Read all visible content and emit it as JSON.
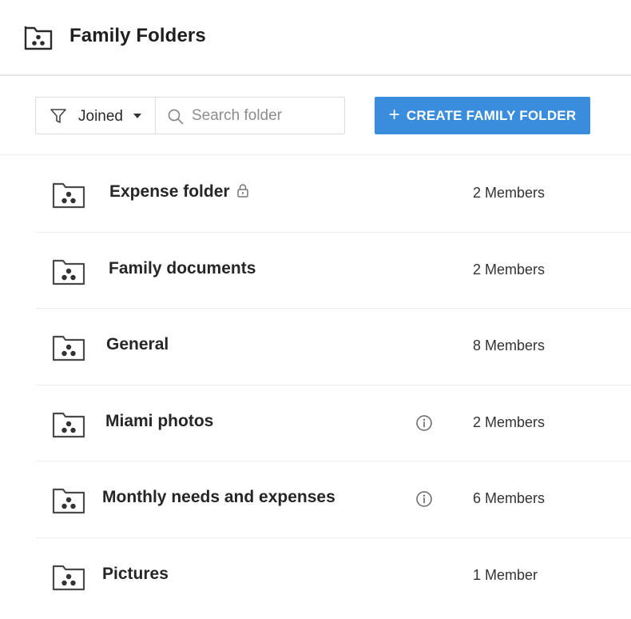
{
  "header": {
    "title": "Family Folders",
    "icon": "family-folder-icon"
  },
  "toolbar": {
    "filter": {
      "icon": "filter-icon",
      "label": "Joined"
    },
    "search": {
      "placeholder": "Search folder",
      "value": ""
    },
    "create_button": {
      "plus": "+",
      "label": "CREATE FAMILY FOLDER"
    }
  },
  "colors": {
    "accent": "#3a8ddc",
    "text": "#262626",
    "border": "#dcdcdc"
  },
  "folders": [
    {
      "name": "Expense folder",
      "locked": true,
      "info": false,
      "members": "2 Members"
    },
    {
      "name": "Family documents",
      "locked": false,
      "info": false,
      "members": "2 Members"
    },
    {
      "name": "General",
      "locked": false,
      "info": false,
      "members": "8 Members"
    },
    {
      "name": "Miami photos",
      "locked": false,
      "info": true,
      "members": "2 Members"
    },
    {
      "name": "Monthly needs and expenses",
      "locked": false,
      "info": true,
      "members": "6 Members"
    },
    {
      "name": "Pictures",
      "locked": false,
      "info": false,
      "members": "1 Member"
    }
  ]
}
